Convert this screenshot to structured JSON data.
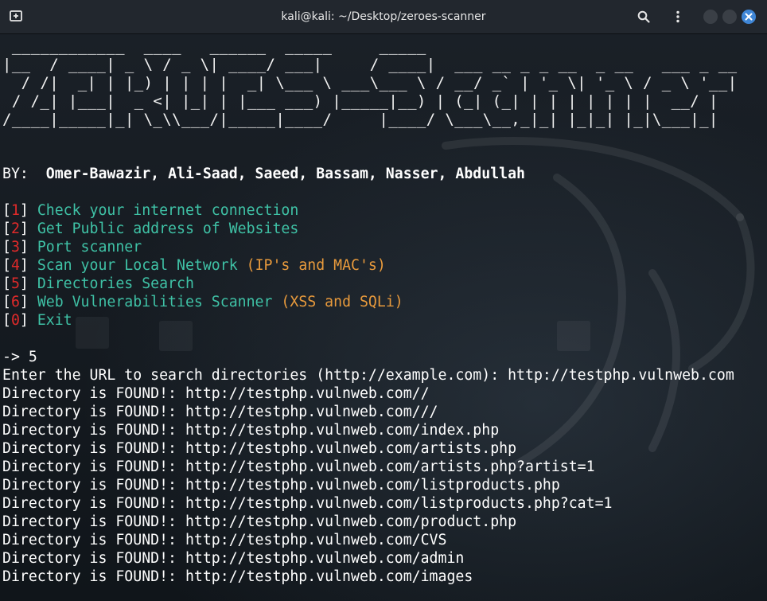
{
  "window": {
    "title": "kali@kali: ~/Desktop/zeroes-scanner"
  },
  "icons": {
    "new_tab": "new-tab-icon",
    "search": "search-icon",
    "menu": "kebab-menu-icon",
    "minimize": "minimize-icon",
    "maximize": "maximize-icon",
    "close": "close-icon"
  },
  "colors": {
    "menu_number": "#e02a2a",
    "menu_text": "#3fc2a6",
    "menu_note": "#e89a3c",
    "close_button": "#3f86d6"
  },
  "banner": [
    " ____________  ____   ______  _____     _____                                       ",
    "|__  / ____| _ \\ / _ \\| ____/ ___|     / ____|  ___ __ _ _ __  _ __   ___ _ __ ",
    "  / /|  _| | |_) | | | |  _| \\___ \\ ___\\___ \\ / __/ _` | '_ \\| '_ \\ / _ \\ '__|",
    " / /_| |___|  _ <| |_| | |___ ___) |_____|__) | (_| (_| | | | | | | |  __/ |   ",
    "/____|_____|_| \\_\\\\___/|_____|____/     |____/ \\___\\__,_|_| |_|_| |_|\\___|_|   "
  ],
  "credits": {
    "label": "BY:",
    "names": "Omer-Bawazir, Ali-Saad, Saeed, Bassam, Nasser, Abdullah"
  },
  "menu": [
    {
      "num": "1",
      "text": "Check your internet connection",
      "note": ""
    },
    {
      "num": "2",
      "text": "Get Public address of Websites",
      "note": ""
    },
    {
      "num": "3",
      "text": "Port scanner",
      "note": ""
    },
    {
      "num": "4",
      "text": "Scan your Local Network",
      "note": "(IP's and MAC's)"
    },
    {
      "num": "5",
      "text": "Directories Search",
      "note": ""
    },
    {
      "num": "6",
      "text": "Web Vulnerabilities Scanner",
      "note": "(XSS and SQLi)"
    },
    {
      "num": "0",
      "text": "Exit",
      "note": ""
    }
  ],
  "prompt": "-> 5",
  "url_prompt": "Enter the URL to search directories (http://example.com): http://testphp.vulnweb.com",
  "results": [
    "Directory is FOUND!: http://testphp.vulnweb.com//",
    "Directory is FOUND!: http://testphp.vulnweb.com///",
    "Directory is FOUND!: http://testphp.vulnweb.com/index.php",
    "Directory is FOUND!: http://testphp.vulnweb.com/artists.php",
    "Directory is FOUND!: http://testphp.vulnweb.com/artists.php?artist=1",
    "Directory is FOUND!: http://testphp.vulnweb.com/listproducts.php",
    "Directory is FOUND!: http://testphp.vulnweb.com/listproducts.php?cat=1",
    "Directory is FOUND!: http://testphp.vulnweb.com/product.php",
    "Directory is FOUND!: http://testphp.vulnweb.com/CVS",
    "Directory is FOUND!: http://testphp.vulnweb.com/admin",
    "Directory is FOUND!: http://testphp.vulnweb.com/images"
  ]
}
